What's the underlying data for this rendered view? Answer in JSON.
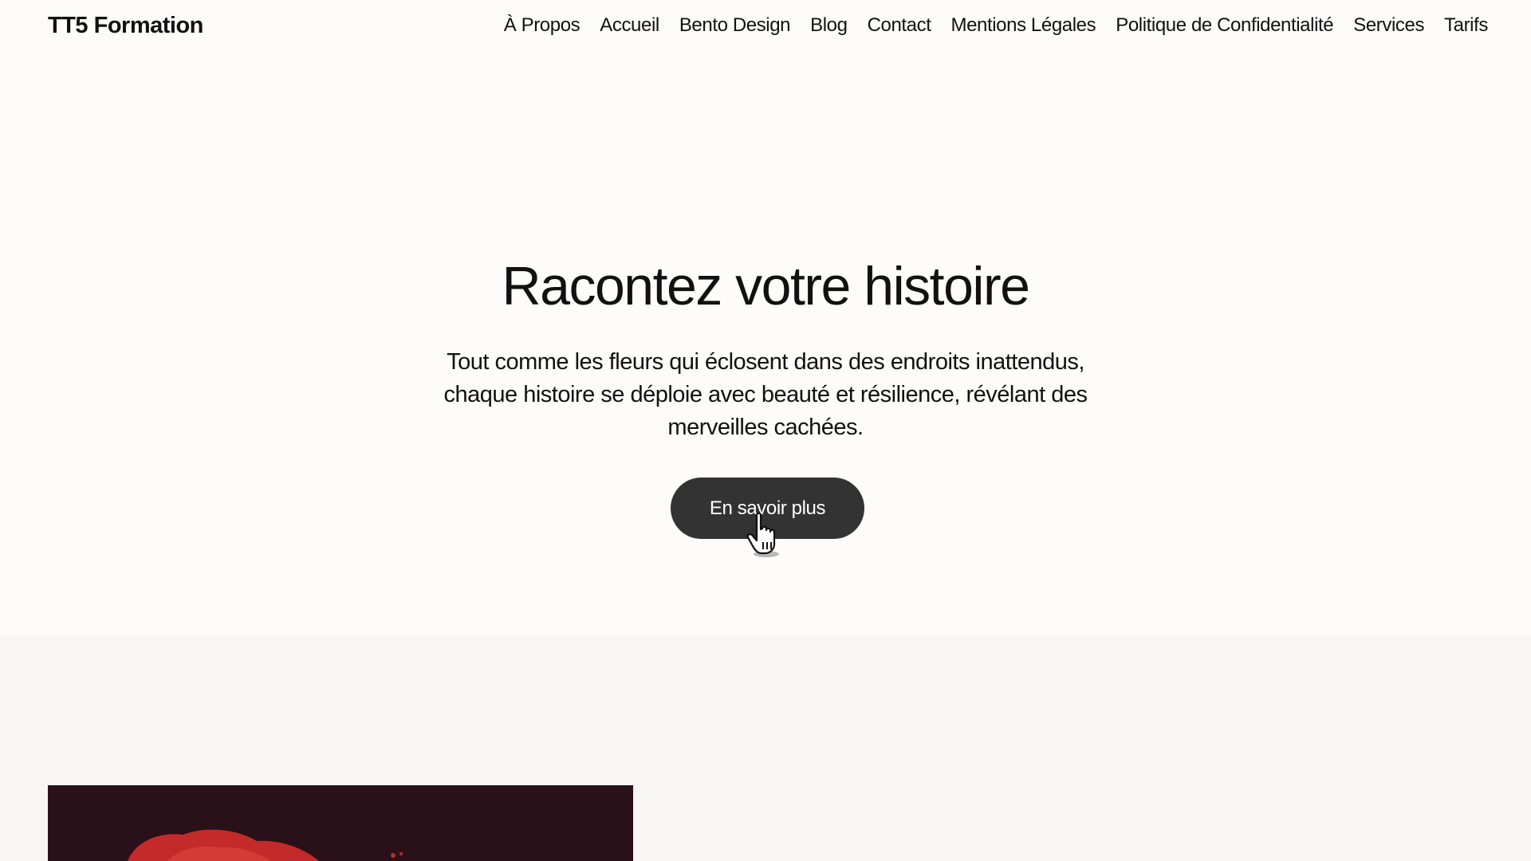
{
  "site": {
    "title": "TT5 Formation"
  },
  "nav": {
    "items": [
      {
        "label": "À Propos"
      },
      {
        "label": "Accueil"
      },
      {
        "label": "Bento Design"
      },
      {
        "label": "Blog"
      },
      {
        "label": "Contact"
      },
      {
        "label": "Mentions Légales"
      },
      {
        "label": "Politique de Confidentialité"
      },
      {
        "label": "Services"
      },
      {
        "label": "Tarifs"
      }
    ]
  },
  "hero": {
    "heading": "Racontez votre histoire",
    "text": "Tout comme les fleurs qui éclosent dans des endroits inattendus, chaque histoire se déploie avec beauté et résilience, révélant des merveilles cachées.",
    "button_label": "En savoir plus"
  },
  "colors": {
    "background": "#fdfcfb",
    "section_background": "#f8f6f2",
    "button_background": "#333333",
    "button_text": "#ffffff",
    "text": "#111111",
    "image_dark": "#2a1018",
    "image_accent": "#c42a2a"
  },
  "icons": {
    "cursor": "hand-pointer-icon"
  }
}
